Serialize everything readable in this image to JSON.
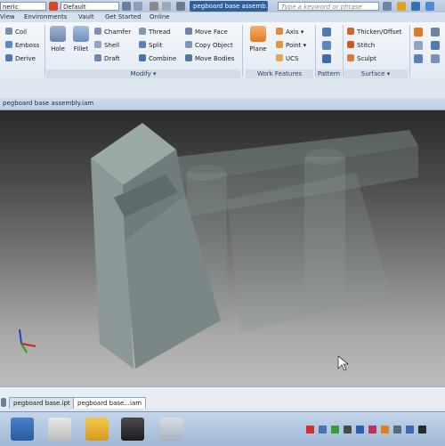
{
  "qat": {
    "workspace_combo": "neric",
    "style_combo": "Default",
    "document_title": "pegboard base assemb...",
    "search_placeholder": "Type a keyword or phrase"
  },
  "menu": {
    "tabs": [
      "View",
      "Environments",
      "Vault",
      "Get Started",
      "Online"
    ]
  },
  "ribbon": {
    "create_small": [
      "Coil",
      "Emboss",
      "Derive"
    ],
    "modify_big": [
      "Hole",
      "Fillet"
    ],
    "modify_col1": [
      "Chamfer",
      "Shell",
      "Draft"
    ],
    "modify_col2": [
      "Thread",
      "Split",
      "Combine"
    ],
    "modify_col3": [
      "Move Face",
      "Copy Object",
      "Move Bodies"
    ],
    "modify_label": "Modify ▾",
    "plane_label": "Plane",
    "work_small": [
      "Axis ▾",
      "Point ▾",
      "UCS"
    ],
    "work_label": "Work Features",
    "pattern_label": "Pattern",
    "surface_items": [
      "Thicken/Offset",
      "Stitch",
      "Sculpt"
    ],
    "surface_label": "Surface ▾"
  },
  "viewport": {
    "title": "pegboard base assembly.iam"
  },
  "doc_tabs": [
    "pegboard base.ipt",
    "pegboard base...iam"
  ],
  "colors": {
    "title_blue": "#2f5f9e",
    "part_gray": "#8a9796"
  }
}
